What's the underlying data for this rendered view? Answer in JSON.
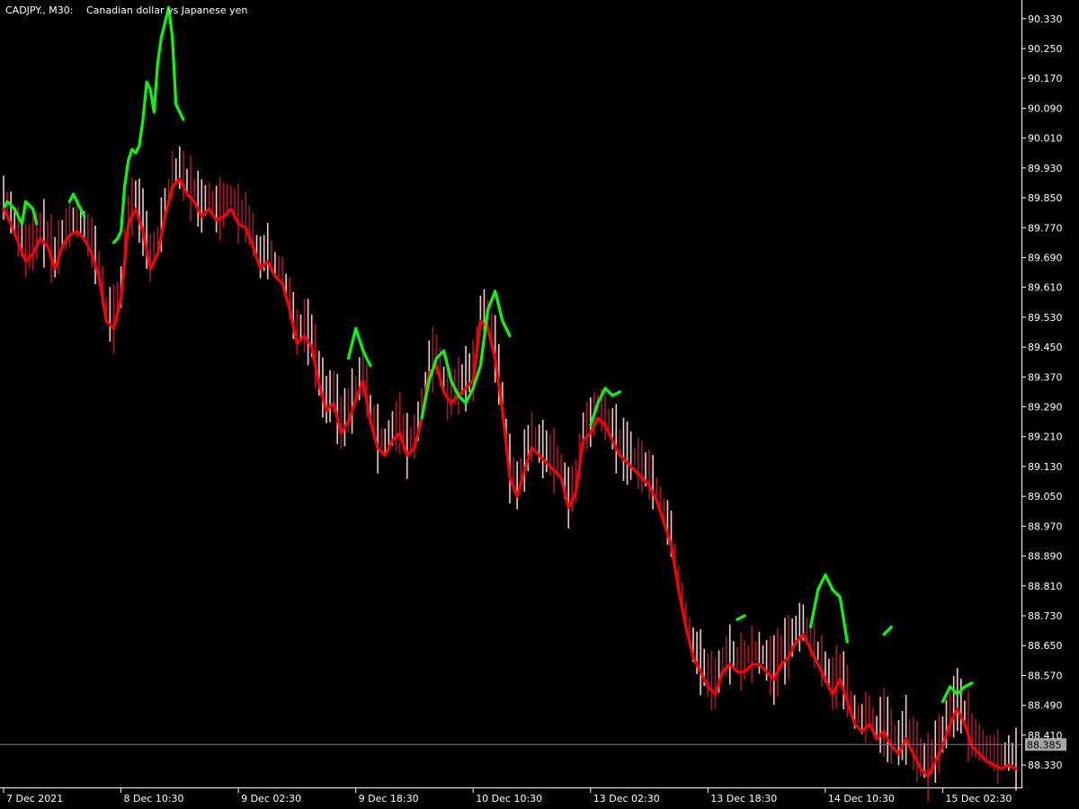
{
  "header": {
    "symbol": "CADJPY., M30:",
    "description": "Canadian dollar vs Japanese yen"
  },
  "colors": {
    "background": "#000000",
    "axis": "#ffffff",
    "up_line": "#00ff00",
    "down_line": "#ff0000",
    "candle_bull": "#f5c6c6",
    "candle_bear": "#b01030",
    "current_price_line": "#7f7f7f",
    "current_price_tag": "#a6a6a6"
  },
  "chart_data": {
    "type": "line",
    "title": "",
    "xlabel": "",
    "ylabel": "",
    "ylim": [
      88.27,
      90.38
    ],
    "grid": false,
    "y_ticks": [
      "90.330",
      "90.250",
      "90.170",
      "90.090",
      "90.010",
      "89.930",
      "89.850",
      "89.770",
      "89.690",
      "89.610",
      "89.530",
      "89.450",
      "89.370",
      "89.290",
      "89.210",
      "89.130",
      "89.050",
      "88.970",
      "88.890",
      "88.810",
      "88.730",
      "88.650",
      "88.570",
      "88.490",
      "88.410",
      "88.330"
    ],
    "x_ticks": [
      "7 Dec 2021",
      "8 Dec 10:30",
      "9 Dec 02:30",
      "9 Dec 18:30",
      "10 Dec 10:30",
      "13 Dec 02:30",
      "13 Dec 18:30",
      "14 Dec 10:30",
      "15 Dec 02:30"
    ],
    "current_price": 88.385,
    "current_price_label": "88.385",
    "x_domain": [
      0,
      276
    ],
    "x_tick_bars": [
      0,
      32,
      64,
      96,
      128,
      160,
      192,
      224,
      256
    ],
    "series": [
      {
        "role": "trend",
        "color": "#00ff00",
        "points": [
          [
            0,
            89.82
          ],
          [
            1,
            89.84
          ],
          [
            2,
            89.83
          ],
          [
            3,
            89.82
          ],
          [
            4,
            89.8
          ],
          [
            5,
            89.78
          ],
          [
            6,
            89.84
          ],
          [
            7,
            89.83
          ],
          [
            8,
            89.82
          ],
          [
            9,
            89.78
          ],
          [
            10,
            89.76
          ],
          [
            11,
            89.8
          ],
          [
            12,
            89.83
          ],
          [
            13,
            89.82
          ],
          [
            14,
            89.8
          ],
          [
            15,
            89.78
          ],
          [
            16,
            89.79
          ],
          [
            17,
            89.8
          ],
          [
            18,
            89.84
          ],
          [
            19,
            89.86
          ],
          [
            20,
            89.84
          ],
          [
            21,
            89.82
          ],
          [
            22,
            89.8
          ],
          [
            23,
            89.83
          ],
          [
            24,
            89.81
          ],
          [
            25,
            89.79
          ],
          [
            26,
            89.77
          ],
          [
            27,
            89.76
          ],
          [
            28,
            89.75
          ],
          [
            29,
            89.74
          ],
          [
            30,
            89.73
          ],
          [
            31,
            89.74
          ],
          [
            32,
            89.76
          ],
          [
            33,
            89.88
          ],
          [
            34,
            89.95
          ],
          [
            35,
            89.98
          ],
          [
            36,
            89.97
          ],
          [
            37,
            89.99
          ],
          [
            38,
            90.06
          ],
          [
            39,
            90.16
          ],
          [
            40,
            90.14
          ],
          [
            41,
            90.08
          ],
          [
            42,
            90.21
          ],
          [
            43,
            90.28
          ],
          [
            44,
            90.32
          ],
          [
            45,
            90.36
          ],
          [
            46,
            90.28
          ],
          [
            47,
            90.1
          ],
          [
            48,
            90.08
          ],
          [
            49,
            90.06
          ]
        ],
        "segments": [
          [
            0,
            10
          ],
          [
            18,
            23
          ],
          [
            30,
            50
          ]
        ]
      },
      {
        "role": "trend",
        "color": "#ff0000",
        "points": [
          [
            0,
            89.82
          ],
          [
            2,
            89.78
          ],
          [
            4,
            89.73
          ],
          [
            6,
            89.68
          ],
          [
            8,
            89.7
          ],
          [
            10,
            89.74
          ],
          [
            12,
            89.72
          ],
          [
            14,
            89.66
          ],
          [
            16,
            89.72
          ],
          [
            18,
            89.75
          ],
          [
            20,
            89.76
          ],
          [
            22,
            89.74
          ],
          [
            24,
            89.7
          ],
          [
            26,
            89.64
          ],
          [
            28,
            89.52
          ],
          [
            30,
            89.5
          ],
          [
            32,
            89.58
          ],
          [
            34,
            89.78
          ],
          [
            36,
            89.82
          ],
          [
            38,
            89.76
          ],
          [
            40,
            89.66
          ],
          [
            42,
            89.7
          ],
          [
            44,
            89.8
          ],
          [
            46,
            89.88
          ],
          [
            48,
            89.9
          ],
          [
            50,
            89.86
          ],
          [
            52,
            89.84
          ],
          [
            54,
            89.8
          ],
          [
            56,
            89.82
          ],
          [
            58,
            89.79
          ],
          [
            60,
            89.8
          ],
          [
            62,
            89.82
          ],
          [
            64,
            89.78
          ],
          [
            66,
            89.77
          ],
          [
            68,
            89.72
          ],
          [
            70,
            89.66
          ],
          [
            72,
            89.68
          ],
          [
            74,
            89.64
          ],
          [
            76,
            89.62
          ],
          [
            78,
            89.55
          ],
          [
            80,
            89.46
          ],
          [
            82,
            89.48
          ],
          [
            84,
            89.45
          ],
          [
            86,
            89.35
          ],
          [
            88,
            89.28
          ],
          [
            90,
            89.3
          ],
          [
            92,
            89.22
          ],
          [
            94,
            89.25
          ],
          [
            96,
            89.31
          ],
          [
            98,
            89.36
          ],
          [
            100,
            89.25
          ],
          [
            102,
            89.18
          ],
          [
            104,
            89.16
          ],
          [
            106,
            89.2
          ],
          [
            108,
            89.22
          ],
          [
            110,
            89.16
          ],
          [
            112,
            89.18
          ]
        ],
        "segments": [
          [
            0,
            57
          ]
        ]
      },
      {
        "role": "trend",
        "color": "#00ff00",
        "points": [
          [
            94,
            89.42
          ],
          [
            96,
            89.5
          ],
          [
            98,
            89.44
          ],
          [
            100,
            89.4
          ]
        ],
        "segments": [
          [
            0,
            4
          ]
        ]
      },
      {
        "role": "trend",
        "color": "#ff0000",
        "points": [
          [
            112,
            89.18
          ],
          [
            114,
            89.26
          ],
          [
            116,
            89.38
          ],
          [
            118,
            89.4
          ],
          [
            120,
            89.33
          ],
          [
            122,
            89.3
          ],
          [
            124,
            89.32
          ],
          [
            126,
            89.34
          ],
          [
            128,
            89.36
          ],
          [
            130,
            89.52
          ],
          [
            132,
            89.5
          ],
          [
            134,
            89.42
          ],
          [
            136,
            89.28
          ],
          [
            138,
            89.1
          ],
          [
            140,
            89.05
          ],
          [
            142,
            89.12
          ],
          [
            144,
            89.18
          ],
          [
            146,
            89.16
          ],
          [
            148,
            89.14
          ],
          [
            150,
            89.12
          ],
          [
            152,
            89.1
          ],
          [
            154,
            89.02
          ],
          [
            156,
            89.06
          ],
          [
            158,
            89.2
          ],
          [
            160,
            89.22
          ],
          [
            162,
            89.26
          ],
          [
            164,
            89.24
          ],
          [
            166,
            89.2
          ],
          [
            168,
            89.16
          ],
          [
            170,
            89.14
          ],
          [
            172,
            89.12
          ],
          [
            174,
            89.1
          ],
          [
            176,
            89.08
          ],
          [
            178,
            89.04
          ],
          [
            180,
            88.98
          ],
          [
            182,
            88.92
          ],
          [
            184,
            88.8
          ],
          [
            186,
            88.7
          ],
          [
            188,
            88.62
          ],
          [
            190,
            88.58
          ],
          [
            192,
            88.54
          ],
          [
            194,
            88.52
          ],
          [
            196,
            88.58
          ],
          [
            198,
            88.6
          ],
          [
            200,
            88.58
          ],
          [
            202,
            88.58
          ],
          [
            204,
            88.6
          ],
          [
            206,
            88.6
          ],
          [
            208,
            88.58
          ],
          [
            210,
            88.56
          ],
          [
            212,
            88.6
          ],
          [
            214,
            88.62
          ],
          [
            216,
            88.66
          ],
          [
            218,
            88.68
          ],
          [
            220,
            88.64
          ],
          [
            222,
            88.6
          ],
          [
            224,
            88.56
          ],
          [
            226,
            88.52
          ],
          [
            228,
            88.56
          ],
          [
            230,
            88.5
          ],
          [
            232,
            88.44
          ],
          [
            234,
            88.42
          ],
          [
            236,
            88.44
          ],
          [
            238,
            88.4
          ],
          [
            240,
            88.42
          ],
          [
            242,
            88.38
          ],
          [
            244,
            88.36
          ],
          [
            246,
            88.4
          ],
          [
            248,
            88.36
          ],
          [
            250,
            88.32
          ],
          [
            252,
            88.3
          ],
          [
            254,
            88.34
          ],
          [
            256,
            88.38
          ],
          [
            258,
            88.44
          ],
          [
            260,
            88.48
          ],
          [
            262,
            88.44
          ],
          [
            264,
            88.38
          ],
          [
            266,
            88.36
          ],
          [
            268,
            88.34
          ],
          [
            270,
            88.33
          ],
          [
            272,
            88.32
          ],
          [
            274,
            88.33
          ],
          [
            276,
            88.32
          ]
        ],
        "segments": [
          [
            0,
            83
          ]
        ]
      },
      {
        "role": "trend",
        "color": "#00ff00",
        "points": [
          [
            114,
            89.26
          ],
          [
            116,
            89.36
          ],
          [
            118,
            89.42
          ],
          [
            120,
            89.44
          ],
          [
            122,
            89.36
          ],
          [
            124,
            89.32
          ],
          [
            126,
            89.3
          ],
          [
            128,
            89.34
          ],
          [
            130,
            89.4
          ],
          [
            132,
            89.55
          ],
          [
            134,
            89.6
          ],
          [
            136,
            89.52
          ],
          [
            138,
            89.48
          ]
        ],
        "segments": [
          [
            0,
            13
          ]
        ]
      },
      {
        "role": "trend",
        "color": "#00ff00",
        "points": [
          [
            160,
            89.24
          ],
          [
            162,
            89.3
          ],
          [
            164,
            89.34
          ],
          [
            166,
            89.32
          ],
          [
            168,
            89.33
          ]
        ],
        "segments": [
          [
            0,
            5
          ]
        ]
      },
      {
        "role": "trend",
        "color": "#00ff00",
        "points": [
          [
            200,
            88.72
          ],
          [
            202,
            88.73
          ]
        ],
        "segments": [
          [
            0,
            2
          ]
        ]
      },
      {
        "role": "trend",
        "color": "#00ff00",
        "points": [
          [
            220,
            88.7
          ],
          [
            222,
            88.8
          ],
          [
            224,
            88.84
          ],
          [
            226,
            88.8
          ],
          [
            228,
            88.78
          ],
          [
            230,
            88.66
          ]
        ],
        "segments": [
          [
            0,
            6
          ]
        ]
      },
      {
        "role": "trend",
        "color": "#00ff00",
        "points": [
          [
            240,
            88.68
          ],
          [
            242,
            88.7
          ]
        ],
        "segments": [
          [
            0,
            2
          ]
        ]
      },
      {
        "role": "trend",
        "color": "#00ff00",
        "points": [
          [
            256,
            88.5
          ],
          [
            258,
            88.54
          ],
          [
            260,
            88.52
          ],
          [
            262,
            88.54
          ],
          [
            264,
            88.55
          ]
        ],
        "segments": [
          [
            0,
            5
          ]
        ]
      }
    ]
  }
}
